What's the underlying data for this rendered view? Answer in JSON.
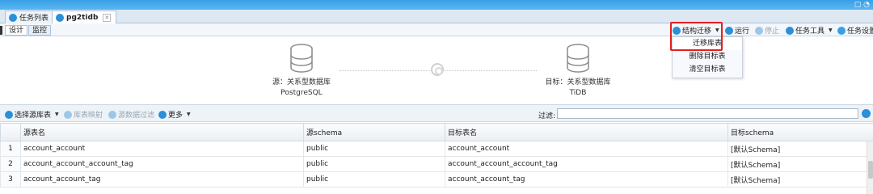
{
  "tabs": [
    {
      "label": "任务列表",
      "icon": "task-list-icon"
    },
    {
      "label": "pg2tidb",
      "icon": "task-icon"
    }
  ],
  "subtabs": [
    "设计",
    "监控"
  ],
  "toolbar": {
    "migrate_struct": "结构迁移",
    "run": "运行",
    "stop": "停止",
    "task_tools": "任务工具",
    "task_settings": "任务设置"
  },
  "dropdown": {
    "items": [
      "迁移库表",
      "删除目标表",
      "清空目标表"
    ]
  },
  "diagram": {
    "source_line1": "源：关系型数据库",
    "source_line2": "PostgreSQL",
    "target_line1": "目标：关系型数据库",
    "target_line2": "TiDB"
  },
  "filterbar": {
    "select_tables": "选择源库表",
    "table_mapping": "库表映射",
    "data_filter": "源数据过滤",
    "more": "更多",
    "filter_label": "过滤:",
    "filter_value": ""
  },
  "table": {
    "headers": [
      "源表名",
      "源schema",
      "目标表名",
      "目标schema"
    ],
    "rows": [
      {
        "n": "1",
        "src": "account_account",
        "src_schema": "public",
        "dst": "account_account",
        "dst_schema": "[默认Schema]"
      },
      {
        "n": "2",
        "src": "account_account_account_tag",
        "src_schema": "public",
        "dst": "account_account_account_tag",
        "dst_schema": "[默认Schema]"
      },
      {
        "n": "3",
        "src": "account_account_tag",
        "src_schema": "public",
        "dst": "account_account_tag",
        "dst_schema": "[默认Schema]"
      }
    ]
  },
  "colors": {
    "accent": "#2d8fd8",
    "highlight_box": "#e41f1f"
  }
}
